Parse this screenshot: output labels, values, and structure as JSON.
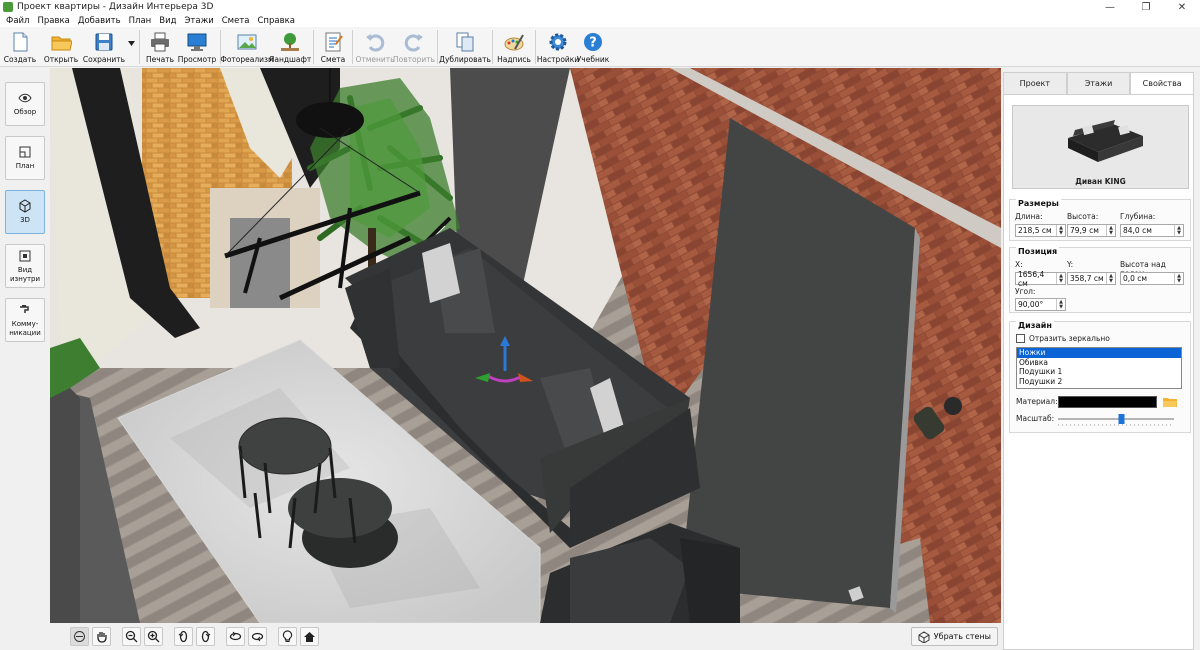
{
  "window": {
    "title": "Проект квартиры - Дизайн Интерьера 3D",
    "controls": [
      "—",
      "❐",
      "✕"
    ]
  },
  "menu": [
    "Файл",
    "Правка",
    "Добавить",
    "План",
    "Вид",
    "Этажи",
    "Смета",
    "Справка"
  ],
  "toolbar": {
    "create": "Создать",
    "open": "Открыть",
    "save": "Сохранить",
    "print": "Печать",
    "preview": "Просмотр",
    "photorealism": "Фотореализм",
    "landscape": "Ландшафт",
    "estimate": "Смета",
    "undo": "Отменить",
    "redo": "Повторить",
    "duplicate": "Дублировать",
    "labels": "Надпись",
    "settings": "Настройки",
    "tutorial": "Учебник"
  },
  "left_panel": {
    "overview": "Обзор",
    "plan": "План",
    "view3d": "3D",
    "inside_1": "Вид",
    "inside_2": "изнутри",
    "comm_1": "Комму-",
    "comm_2": "никации"
  },
  "bottom_bar": {
    "hide_walls": "Убрать стены"
  },
  "right_panel": {
    "tabs": [
      "Проект",
      "Этажи",
      "Свойства"
    ],
    "active_tab": "Свойства",
    "object_name": "Диван KING",
    "dimensions": {
      "title": "Размеры",
      "length_label": "Длина:",
      "length": "218,5 см",
      "height_label": "Высота:",
      "height": "79,9 см",
      "depth_label": "Глубина:",
      "depth": "84,0 см"
    },
    "position": {
      "title": "Позиция",
      "x_label": "X:",
      "x": "1656,4 см",
      "y_label": "Y:",
      "y": "358,7 см",
      "elev_label": "Высота над полом:",
      "elev": "0,0 см",
      "angle_label": "Угол:",
      "angle": "90,00°"
    },
    "design": {
      "title": "Дизайн",
      "mirror_label": "Отразить зеркально",
      "parts": [
        "Ножки",
        "Обивка",
        "Подушки 1",
        "Подушки 2"
      ],
      "selected_part": "Ножки",
      "material_label": "Материал:",
      "material_color": "#000000",
      "scale_label": "Масштаб:",
      "scale_level": 0.55
    }
  },
  "colors": {
    "accent": "#0a64d6",
    "active_button": "#cde4f7"
  }
}
